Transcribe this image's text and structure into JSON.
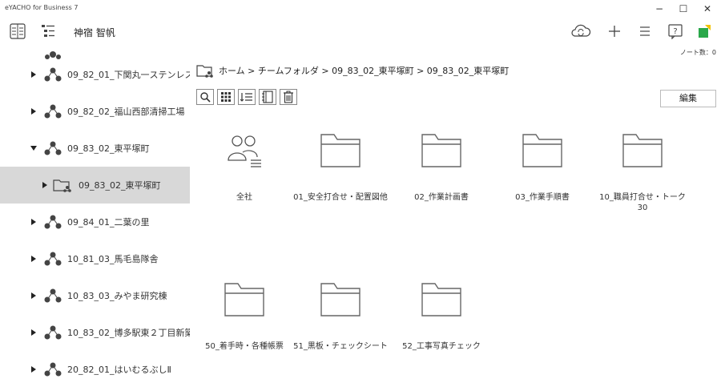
{
  "app": {
    "title": "eYACHO for Business 7"
  },
  "window_controls": {
    "minimize": "−",
    "maximize": "☐",
    "close": "✕"
  },
  "toolbar": {
    "user": "神宿 智帆"
  },
  "sidebar": {
    "items": [
      {
        "label": "09_82_01_下関丸一ステンレス"
      },
      {
        "label": "09_82_02_福山西部清掃工場"
      },
      {
        "label": "09_83_02_東平塚町"
      },
      {
        "label": "09_83_02_東平塚町"
      },
      {
        "label": "09_84_01_二葉の里"
      },
      {
        "label": "10_81_03_馬毛島隊舎"
      },
      {
        "label": "10_83_03_みやま研究棟"
      },
      {
        "label": "10_83_02_博多駅東２丁目新築"
      },
      {
        "label": "20_82_01_はいむるぶしⅡ"
      }
    ]
  },
  "main": {
    "note_count": "ノート数：0",
    "breadcrumb": "ホーム > チームフォルダ > 09_83_02_東平塚町 > 09_83_02_東平塚町",
    "edit_label": "編集",
    "tiles": [
      {
        "label": "全社",
        "icon": "people-icon"
      },
      {
        "label": "01_安全打合せ・配置図他",
        "icon": "folder-icon"
      },
      {
        "label": "02_作業計画書",
        "icon": "folder-icon"
      },
      {
        "label": "03_作業手順書",
        "icon": "folder-icon"
      },
      {
        "label": "10_職員打合せ・トーク30",
        "icon": "folder-icon"
      },
      {
        "label": "50_着手時・各種帳票",
        "icon": "folder-icon"
      },
      {
        "label": "51_黒板・チェックシート",
        "icon": "folder-icon"
      },
      {
        "label": "52_工事写真チェック",
        "icon": "folder-icon"
      }
    ]
  },
  "colors": {
    "selected_bg": "#d8d8d8",
    "icon_gray": "#555555",
    "folder_stroke": "#666666"
  }
}
